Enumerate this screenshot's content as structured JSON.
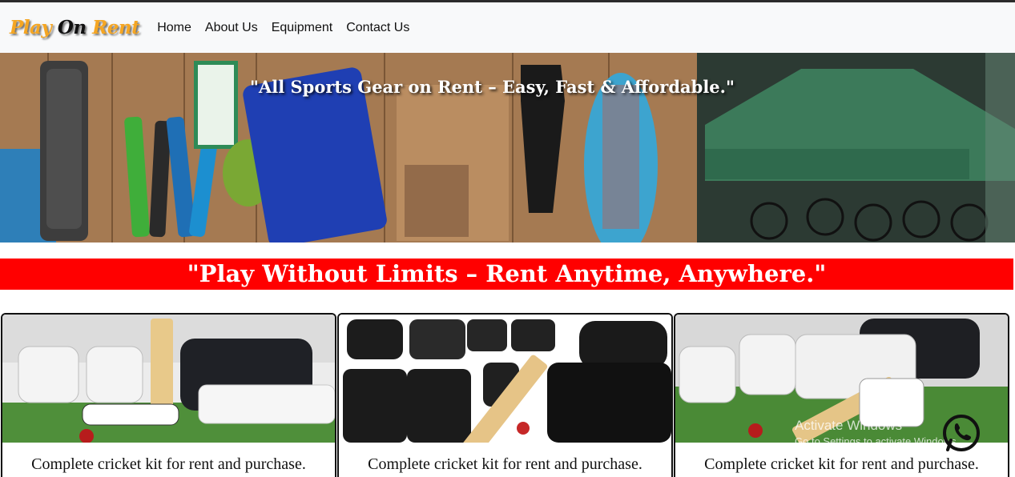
{
  "brand": {
    "part1": "Play",
    "part2": "On",
    "part3": "Rent"
  },
  "nav": {
    "items": [
      "Home",
      "About Us",
      "Equipment",
      "Contact Us"
    ]
  },
  "hero": {
    "quote": "\"All Sports Gear on Rent – Easy, Fast & Affordable.\""
  },
  "banner": {
    "text": "\"Play Without Limits – Rent Anytime, Anywhere.\""
  },
  "cards": [
    {
      "caption": "Complete cricket kit for rent and purchase."
    },
    {
      "caption": "Complete cricket kit for rent and purchase."
    },
    {
      "caption": "Complete cricket kit for rent and purchase."
    }
  ],
  "watermark": {
    "line1": "Activate Windows",
    "line2": "Go to Settings to activate Windows."
  },
  "colors": {
    "banner": "#ff0000",
    "brand_accent": "#f5a623",
    "navbar_bg": "#f8f9fa"
  },
  "icons": {
    "whatsapp": "whatsapp-icon"
  }
}
